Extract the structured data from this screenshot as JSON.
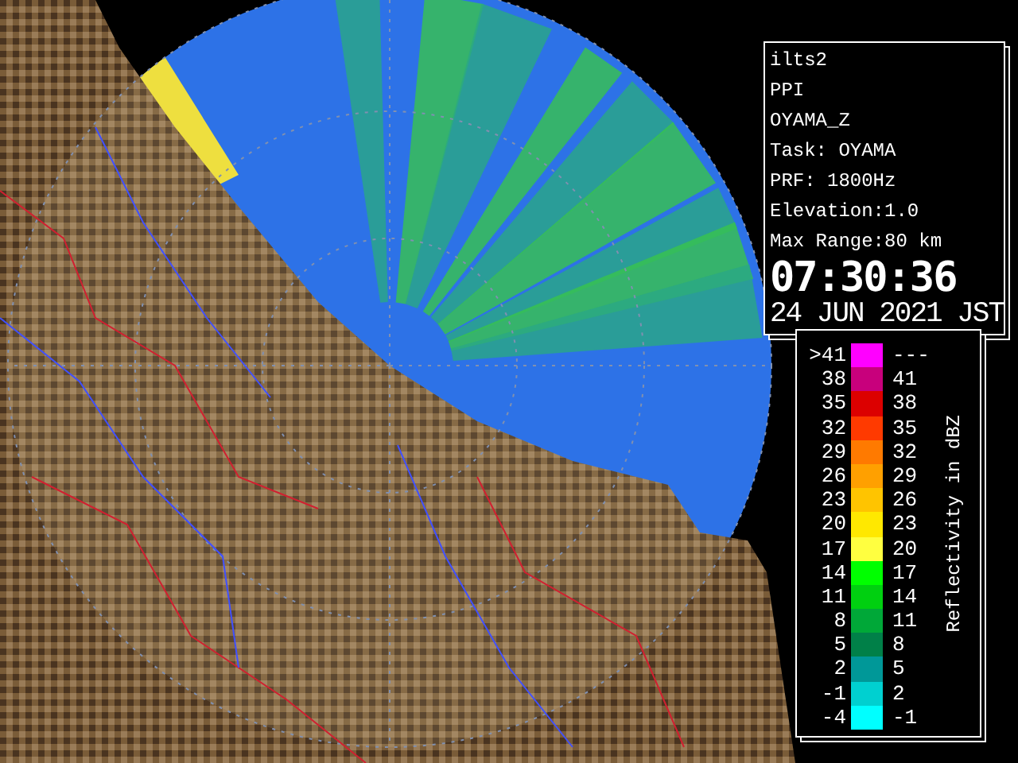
{
  "info_panel": {
    "lines": [
      "ilts2",
      "PPI",
      "OYAMA_Z",
      "Task: OYAMA",
      "PRF: 1800Hz",
      "Elevation:1.0",
      "Max Range:80 km"
    ],
    "time": "07:30:36",
    "date": "24 JUN 2021 JST"
  },
  "legend": {
    "title": "Reflectivity in dBZ",
    "rows": [
      {
        "low": ">41",
        "high": "---",
        "color": "#ff00ff"
      },
      {
        "low": "38",
        "high": "41",
        "color": "#c8007c"
      },
      {
        "low": "35",
        "high": "38",
        "color": "#dc0000"
      },
      {
        "low": "32",
        "high": "35",
        "color": "#ff3a00"
      },
      {
        "low": "29",
        "high": "32",
        "color": "#ff7a00"
      },
      {
        "low": "26",
        "high": "29",
        "color": "#ffa000"
      },
      {
        "low": "23",
        "high": "26",
        "color": "#ffc400"
      },
      {
        "low": "20",
        "high": "23",
        "color": "#ffe800"
      },
      {
        "low": "17",
        "high": "20",
        "color": "#ffff40"
      },
      {
        "low": "14",
        "high": "17",
        "color": "#00ff00"
      },
      {
        "low": "11",
        "high": "14",
        "color": "#00d010"
      },
      {
        "low": "8",
        "high": "11",
        "color": "#00a838"
      },
      {
        "low": "5",
        "high": "8",
        "color": "#008048"
      },
      {
        "low": "2",
        "high": "5",
        "color": "#009898"
      },
      {
        "low": "-1",
        "high": "2",
        "color": "#00d0d0"
      },
      {
        "low": "-4",
        "high": "-1",
        "color": "#00ffff"
      }
    ]
  }
}
